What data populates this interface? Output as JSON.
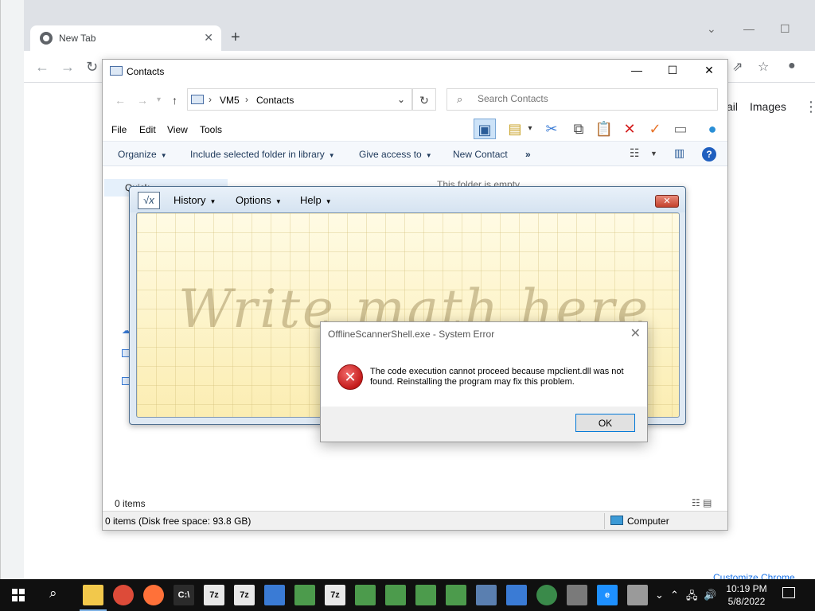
{
  "chrome": {
    "tab_title": "New Tab",
    "tab_close": "✕",
    "new_tab": "+",
    "gmail_fragment": "ail",
    "images_link": "Images",
    "customize": "Customize Chrome"
  },
  "explorer": {
    "title": "Contacts",
    "address": {
      "root": "VM5",
      "current": "Contacts"
    },
    "search_placeholder": "Search Contacts",
    "menu": [
      "File",
      "Edit",
      "View",
      "Tools"
    ],
    "commands": {
      "organize": "Organize",
      "include": "Include selected folder in library",
      "give_access": "Give access to",
      "new_contact": "New Contact",
      "more": "»"
    },
    "nav_quick": "Quick",
    "empty_text": "This folder is empty.",
    "item_count": "0 items",
    "status_left": "0 items (Disk free space: 93.8 GB)",
    "status_right": "Computer"
  },
  "math_panel": {
    "menus": [
      "History",
      "Options",
      "Help"
    ],
    "placeholder": "Write math here"
  },
  "error_dialog": {
    "title": "OfflineScannerShell.exe - System Error",
    "message": "The code execution cannot proceed because mpclient.dll was not found. Reinstalling the program may fix this problem.",
    "ok_label": "OK"
  },
  "taskbar": {
    "time": "10:19 PM",
    "date": "5/8/2022",
    "pinned": [
      {
        "name": "file-explorer",
        "label": "",
        "color": "#f2c84b"
      },
      {
        "name": "chrome",
        "label": "",
        "color": "#dd4b39"
      },
      {
        "name": "firefox",
        "label": "",
        "color": "#ff7139"
      },
      {
        "name": "command-prompt",
        "label": "C:\\",
        "color": "#2b2b2b"
      },
      {
        "name": "7zip",
        "label": "7z",
        "color": "#e8e8e8"
      },
      {
        "name": "7zip",
        "label": "7z",
        "color": "#e8e8e8"
      },
      {
        "name": "app-window",
        "label": "",
        "color": "#3a7bd5"
      },
      {
        "name": "app-window",
        "label": "",
        "color": "#4c9b4c"
      },
      {
        "name": "7zip-error",
        "label": "7z",
        "color": "#e8e8e8"
      },
      {
        "name": "app-window",
        "label": "",
        "color": "#4c9b4c"
      },
      {
        "name": "app-window",
        "label": "",
        "color": "#4c9b4c"
      },
      {
        "name": "app-window",
        "label": "",
        "color": "#4c9b4c"
      },
      {
        "name": "app-window",
        "label": "",
        "color": "#4c9b4c"
      },
      {
        "name": "math-input",
        "label": "",
        "color": "#5a7fb0"
      },
      {
        "name": "contacts",
        "label": "",
        "color": "#3a7bd5"
      },
      {
        "name": "network-globe",
        "label": "",
        "color": "#3a8a4a"
      },
      {
        "name": "scanner",
        "label": "",
        "color": "#7a7a7a"
      },
      {
        "name": "internet-explorer",
        "label": "e",
        "color": "#1e90ff"
      },
      {
        "name": "system-error",
        "label": "",
        "color": "#9a9a9a"
      }
    ]
  }
}
